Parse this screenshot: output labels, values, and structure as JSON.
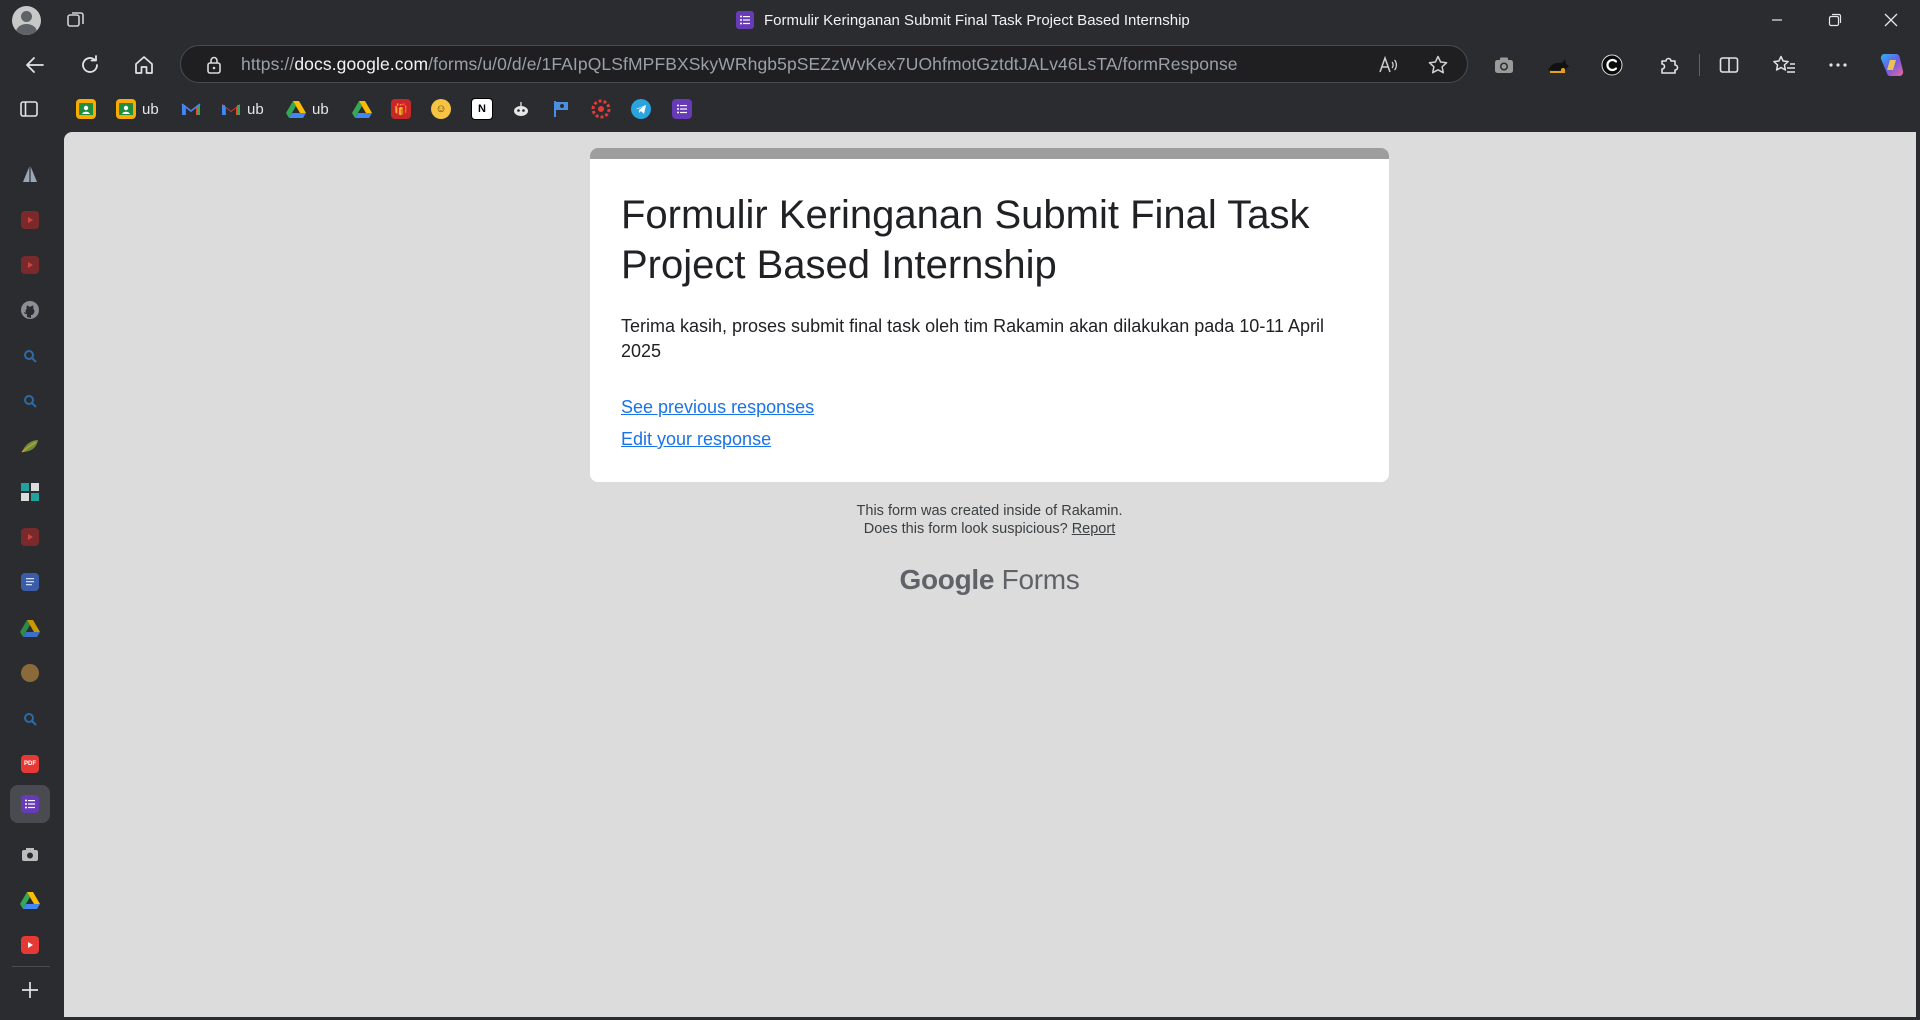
{
  "window": {
    "title": "Formulir Keringanan Submit Final Task Project Based Internship"
  },
  "address_bar": {
    "url_prefix": "https://",
    "url_host": "docs.google.com",
    "url_path": "/forms/u/0/d/e/1FAIpQLSfMPFBXSkyWRhgb5pSEZzWvKex7UOhfmotGztdtJALv46LsTA/formResponse"
  },
  "bookmarks": [
    {
      "icon": "classroom-icon",
      "label": ""
    },
    {
      "icon": "classroom-icon",
      "label": "ub"
    },
    {
      "icon": "gmail-icon",
      "label": ""
    },
    {
      "icon": "gmail-icon",
      "label": "ub"
    },
    {
      "icon": "drive-icon",
      "label": "ub"
    },
    {
      "icon": "drive-icon",
      "label": ""
    },
    {
      "icon": "gift-icon",
      "label": ""
    },
    {
      "icon": "emoji-icon",
      "label": ""
    },
    {
      "icon": "notion-icon",
      "label": ""
    },
    {
      "icon": "bot-icon",
      "label": ""
    },
    {
      "icon": "flag-icon",
      "label": ""
    },
    {
      "icon": "gear-red-icon",
      "label": ""
    },
    {
      "icon": "telegram-icon",
      "label": ""
    },
    {
      "icon": "forms-icon",
      "label": ""
    }
  ],
  "form": {
    "title": "Formulir Keringanan Submit Final Task Project Based Internship",
    "confirmation": "Terima kasih, proses submit final task oleh tim Rakamin akan dilakukan pada 10-11 April 2025",
    "link_previous": "See previous responses",
    "link_edit": "Edit your response"
  },
  "footer": {
    "created_by": "This form was created inside of Rakamin.",
    "suspicious": "Does this form look suspicious?",
    "report": "Report",
    "brand_google": "Google",
    "brand_forms": "Forms"
  },
  "colors": {
    "accent": "#673ab7",
    "link": "#1a73e8",
    "card_header": "#9e9e9e",
    "page_bg": "#dcdcdc"
  }
}
